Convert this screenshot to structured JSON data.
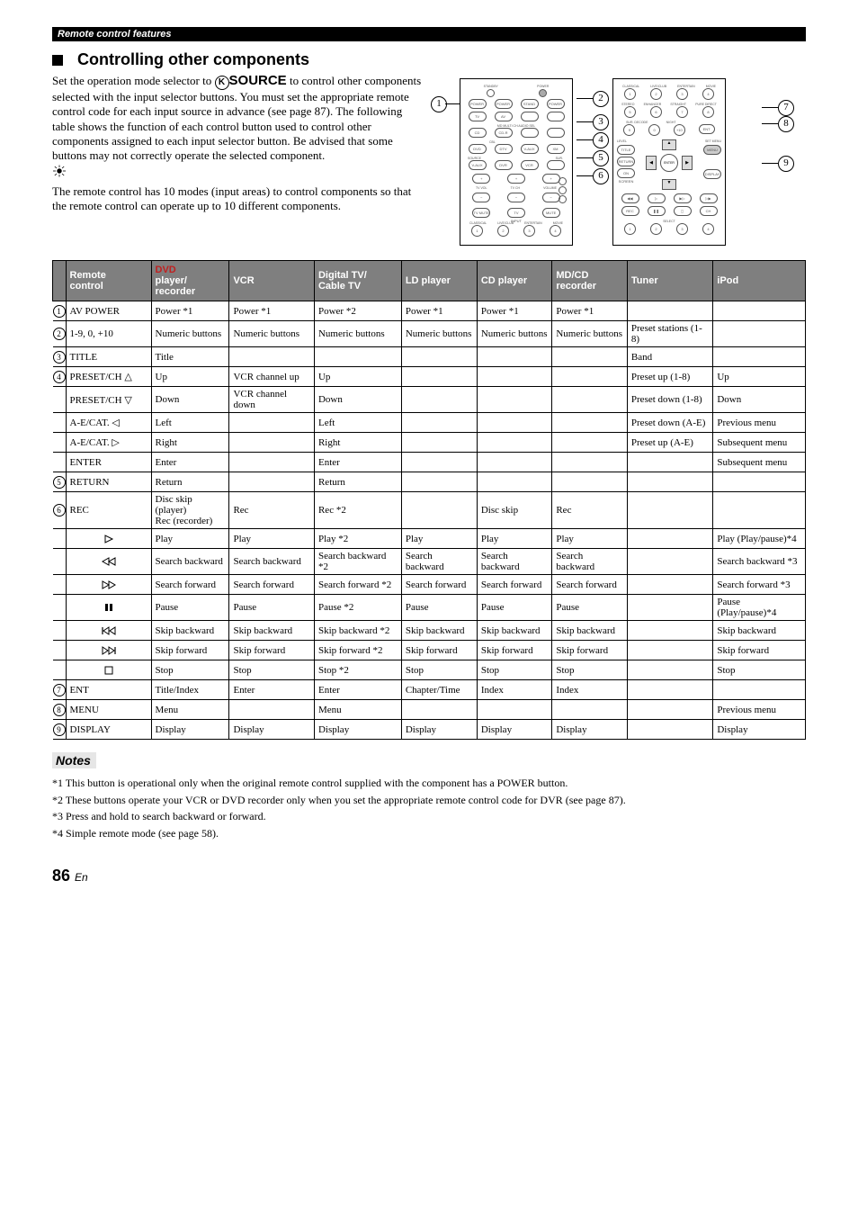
{
  "breadcrumb": "Remote control features",
  "heading": "Controlling other components",
  "body": {
    "p1a": "Set the operation mode selector to ",
    "p1_source": "SOURCE",
    "p1b": " to control other components selected with the input selector buttons. You must set the appropriate remote control code for each input source in advance (see page 87). The following table shows the function of each control button used to control other components assigned to each input selector button. Be advised that some buttons may not correctly operate the selected component.",
    "p2": "The remote control has 10 modes (input areas) to control components so that the remote control can operate up to 10 different components."
  },
  "table": {
    "headers": [
      "Remote control",
      "DVD player/ recorder",
      "VCR",
      "Digital TV/ Cable TV",
      "LD player",
      "CD player",
      "MD/CD recorder",
      "Tuner",
      "iPod"
    ],
    "rows": [
      {
        "num": "1",
        "label": "AV POWER",
        "cells": [
          "Power *1",
          "Power *1",
          "Power *2",
          "Power *1",
          "Power *1",
          "Power *1",
          "",
          ""
        ]
      },
      {
        "num": "2",
        "label": "1-9, 0, +10",
        "cells": [
          "Numeric buttons",
          "Numeric buttons",
          "Numeric buttons",
          "Numeric buttons",
          "Numeric buttons",
          "Numeric buttons",
          "Preset stations (1-8)",
          ""
        ]
      },
      {
        "num": "3",
        "label": "TITLE",
        "cells": [
          "Title",
          "",
          "",
          "",
          "",
          "",
          "Band",
          ""
        ]
      },
      {
        "num": "4",
        "label": "PRESET/CH △",
        "cells": [
          "Up",
          "VCR channel up",
          "Up",
          "",
          "",
          "",
          "Preset up (1-8)",
          "Up"
        ]
      },
      {
        "num": "",
        "label": "PRESET/CH ▽",
        "cells": [
          "Down",
          "VCR channel down",
          "Down",
          "",
          "",
          "",
          "Preset down (1-8)",
          "Down"
        ]
      },
      {
        "num": "",
        "label": "A-E/CAT. ◁",
        "cells": [
          "Left",
          "",
          "Left",
          "",
          "",
          "",
          "Preset down (A-E)",
          "Previous menu"
        ]
      },
      {
        "num": "",
        "label": "A-E/CAT. ▷",
        "cells": [
          "Right",
          "",
          "Right",
          "",
          "",
          "",
          "Preset up (A-E)",
          "Subsequent menu"
        ]
      },
      {
        "num": "",
        "label": "ENTER",
        "cells": [
          "Enter",
          "",
          "Enter",
          "",
          "",
          "",
          "",
          "Subsequent menu"
        ]
      },
      {
        "num": "5",
        "label": "RETURN",
        "cells": [
          "Return",
          "",
          "Return",
          "",
          "",
          "",
          "",
          ""
        ]
      },
      {
        "num": "6",
        "label": "REC",
        "cells": [
          "Disc skip (player)\nRec (recorder)",
          "Rec",
          "Rec *2",
          "",
          "Disc skip",
          "Rec",
          "",
          ""
        ]
      },
      {
        "num": "",
        "icon": "play",
        "cells": [
          "Play",
          "Play",
          "Play *2",
          "Play",
          "Play",
          "Play",
          "",
          "Play (Play/pause)*4"
        ]
      },
      {
        "num": "",
        "icon": "rew",
        "cells": [
          "Search backward",
          "Search backward",
          "Search backward *2",
          "Search backward",
          "Search backward",
          "Search backward",
          "",
          "Search backward *3"
        ]
      },
      {
        "num": "",
        "icon": "ffwd",
        "cells": [
          "Search forward",
          "Search forward",
          "Search forward *2",
          "Search forward",
          "Search forward",
          "Search forward",
          "",
          "Search forward *3"
        ]
      },
      {
        "num": "",
        "icon": "pause",
        "cells": [
          "Pause",
          "Pause",
          "Pause *2",
          "Pause",
          "Pause",
          "Pause",
          "",
          "Pause (Play/pause)*4"
        ]
      },
      {
        "num": "",
        "icon": "prev",
        "cells": [
          "Skip backward",
          "Skip backward",
          "Skip backward *2",
          "Skip backward",
          "Skip backward",
          "Skip backward",
          "",
          "Skip backward"
        ]
      },
      {
        "num": "",
        "icon": "next",
        "cells": [
          "Skip forward",
          "Skip forward",
          "Skip forward *2",
          "Skip forward",
          "Skip forward",
          "Skip forward",
          "",
          "Skip forward"
        ]
      },
      {
        "num": "",
        "icon": "stop",
        "cells": [
          "Stop",
          "Stop",
          "Stop *2",
          "Stop",
          "Stop",
          "Stop",
          "",
          "Stop"
        ]
      },
      {
        "num": "7",
        "label": "ENT",
        "cells": [
          "Title/Index",
          "Enter",
          "Enter",
          "Chapter/Time",
          "Index",
          "Index",
          "",
          ""
        ]
      },
      {
        "num": "8",
        "label": "MENU",
        "cells": [
          "Menu",
          "",
          "Menu",
          "",
          "",
          "",
          "",
          "Previous menu"
        ]
      },
      {
        "num": "9",
        "label": "DISPLAY",
        "cells": [
          "Display",
          "Display",
          "Display",
          "Display",
          "Display",
          "Display",
          "",
          "Display"
        ]
      }
    ]
  },
  "notes_label": "Notes",
  "footnotes": [
    "*1 This button is operational only when the original remote control supplied with the component has a POWER button.",
    "*2 These buttons operate your VCR or DVD recorder only when you set the appropriate remote control code for DVR (see page 87).",
    "*3 Press and hold to search backward or forward.",
    "*4 Simple remote mode (see page 58)."
  ],
  "page_number": "86",
  "page_lang": "En",
  "remote1": {
    "toprow": [
      "POWER",
      "POWER",
      "STAND",
      "POWER"
    ],
    "r2": [
      "TV",
      "AV",
      "",
      ""
    ],
    "r3": [
      "CD",
      "CD-R",
      "",
      ""
    ],
    "r4": [
      "DVD",
      "DTV",
      "V-AUX",
      "XM"
    ],
    "r5": [
      "V-AUX",
      "DVR",
      "VCR",
      ""
    ],
    "vol": [
      "+",
      "+",
      "+"
    ],
    "voll": [
      "TV VOL",
      "TV CH",
      "VOLUME"
    ],
    "minus": [
      "−",
      "−",
      "−"
    ],
    "bottom": [
      "TV MUTE",
      "TV INPUT",
      "MUTE"
    ],
    "foot": [
      "CLASSICAL",
      "LIVE/CLUB",
      "ENTERTAIN",
      "MOVIE"
    ]
  },
  "remote2": {
    "top": [
      "CLASSICAL",
      "LIVE/CLUB",
      "ENTERTAIN",
      "MOVIE"
    ],
    "nums1": [
      "1",
      "2",
      "3",
      "4"
    ],
    "row2l": [
      "STEREO",
      "ENHANCER",
      "STRAIGHT",
      "PURE DIRECT"
    ],
    "nums2": [
      "5",
      "6",
      "7",
      "8"
    ],
    "row3l": [
      "SUR. DECODE",
      "NIGHT",
      "",
      ""
    ],
    "nums3": [
      "9",
      "0",
      "+10",
      "ENT"
    ],
    "side": [
      "LEVEL",
      "TITLE",
      "RETURN",
      "ON SCREEN"
    ],
    "sideR": [
      "SET MENU",
      "MENU",
      "DISPLAY"
    ],
    "dpad": [
      "▲",
      "◀",
      "ENTER",
      "▶",
      "▼"
    ],
    "botrow1": [
      "REC",
      "",
      "",
      ""
    ],
    "botrow2": [
      "",
      "",
      "",
      ""
    ],
    "foot": [
      "1",
      "2",
      "3",
      "4"
    ]
  }
}
